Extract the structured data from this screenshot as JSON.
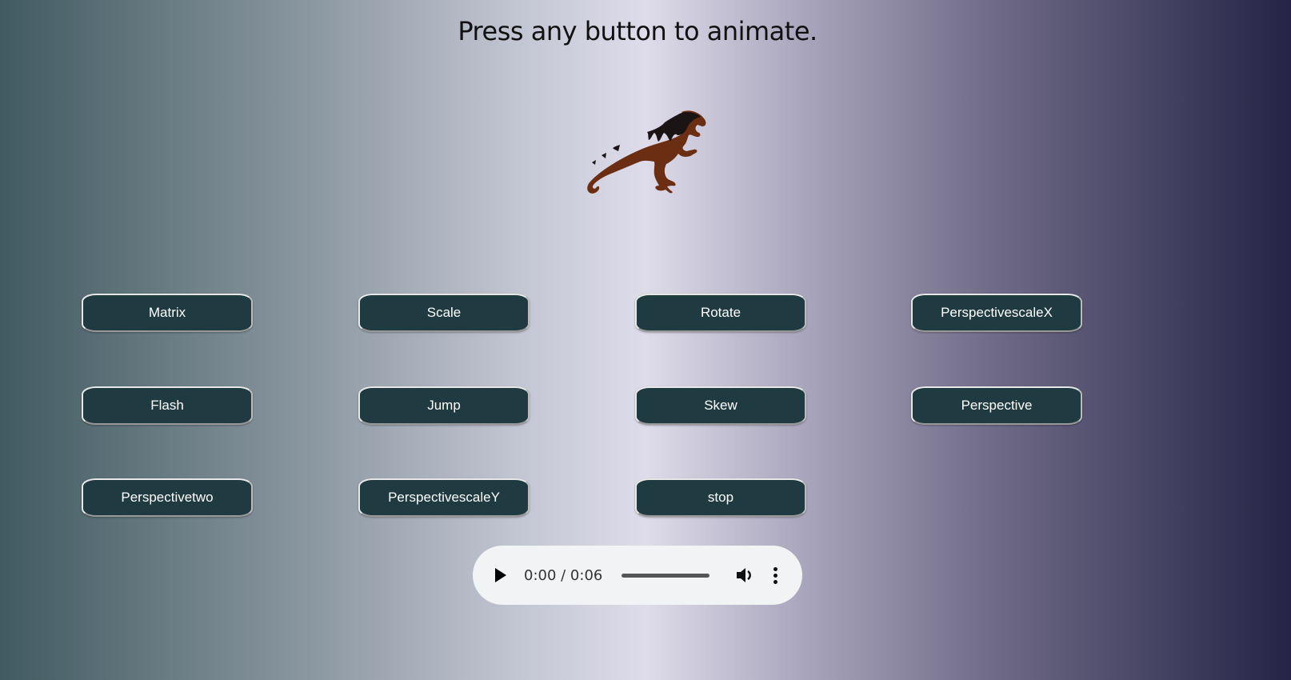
{
  "header": {
    "title": "Press any button to animate."
  },
  "buttons": [
    "Matrix",
    "Scale",
    "Rotate",
    "PerspectivescaleX",
    "Flash",
    "Jump",
    "Skew",
    "Perspective",
    "Perspectivetwo",
    "PerspectivescaleY",
    "stop"
  ],
  "audio": {
    "time": "0:00 / 0:06",
    "progress": 0
  },
  "colors": {
    "button_bg": "#1f3a41",
    "dino_body": "#6b2e12",
    "dino_stripes": "#1a1414"
  }
}
